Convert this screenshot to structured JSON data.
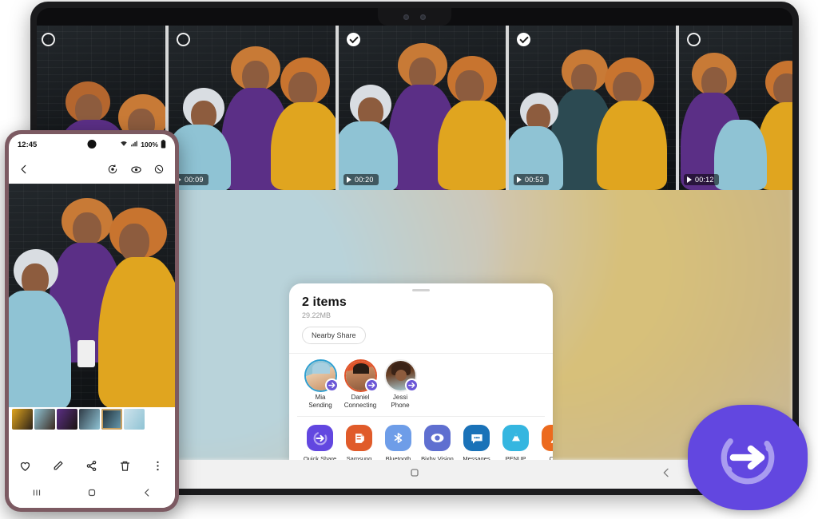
{
  "tablet": {
    "gallery": {
      "thumbnails": [
        {
          "selected": false,
          "duration": "",
          "has_video": false
        },
        {
          "selected": false,
          "duration": "00:09",
          "has_video": true
        },
        {
          "selected": true,
          "duration": "00:20",
          "has_video": true
        },
        {
          "selected": true,
          "duration": "00:53",
          "has_video": true
        },
        {
          "selected": false,
          "duration": "00:12",
          "has_video": true
        }
      ]
    },
    "share_sheet": {
      "title": "2 items",
      "size": "29.22MB",
      "nearby_share_label": "Nearby Share",
      "contacts": [
        {
          "name": "Mia",
          "status": "Sending",
          "badge_icon": "quick-share-arrow-icon",
          "ring_color": "#2f9fd0"
        },
        {
          "name": "Daniel",
          "status": "Connecting",
          "badge_icon": "quick-share-arrow-icon",
          "ring_color": "#e0542a"
        },
        {
          "name": "Jessi",
          "status": "Phone",
          "badge_icon": "quick-share-arrow-icon",
          "ring_color": "#ffffff"
        }
      ],
      "apps": [
        {
          "label": "Quick Share",
          "sublabel": "",
          "icon": "quick-share-icon",
          "color": "#6247e0"
        },
        {
          "label": "Samsung Notes",
          "sublabel": "",
          "icon": "samsung-notes-icon",
          "color": "#e05b2a"
        },
        {
          "label": "Bluetooth",
          "sublabel": "",
          "icon": "bluetooth-icon",
          "color": "#6e9de8"
        },
        {
          "label": "Bixby Vision",
          "sublabel": "",
          "icon": "bixby-vision-icon",
          "color": "#5f6fd0"
        },
        {
          "label": "Messages",
          "sublabel": "",
          "icon": "messages-icon",
          "color": "#1a72b8"
        },
        {
          "label": "PENUP",
          "sublabel": "",
          "icon": "penup-icon",
          "color": "#35b6e0"
        },
        {
          "label": "Con",
          "sublabel": "Conta",
          "icon": "contacts-icon",
          "color": "#ec6a1e"
        }
      ]
    },
    "nav": {
      "recents": "recents-icon",
      "home": "home-icon",
      "back": "back-icon"
    }
  },
  "phone": {
    "status": {
      "time": "12:45",
      "battery": "100%",
      "wifi": "wifi-icon",
      "signal": "signal-icon"
    },
    "toolbar": {
      "back": "back-chevron-icon",
      "actions": [
        "motion-photo-icon",
        "view-icon",
        "ar-doodle-icon"
      ]
    },
    "actions": [
      "favorite-heart-icon",
      "edit-pencil-icon",
      "share-icon",
      "delete-trash-icon",
      "more-options-icon"
    ],
    "filmstrip_count": 6,
    "active_thumb_index": 4,
    "nav": {
      "recents": "recents-icon",
      "home": "home-icon",
      "back": "back-icon"
    }
  },
  "branding": {
    "logo": "quick-share-logo",
    "logo_color": "#6247e0"
  }
}
